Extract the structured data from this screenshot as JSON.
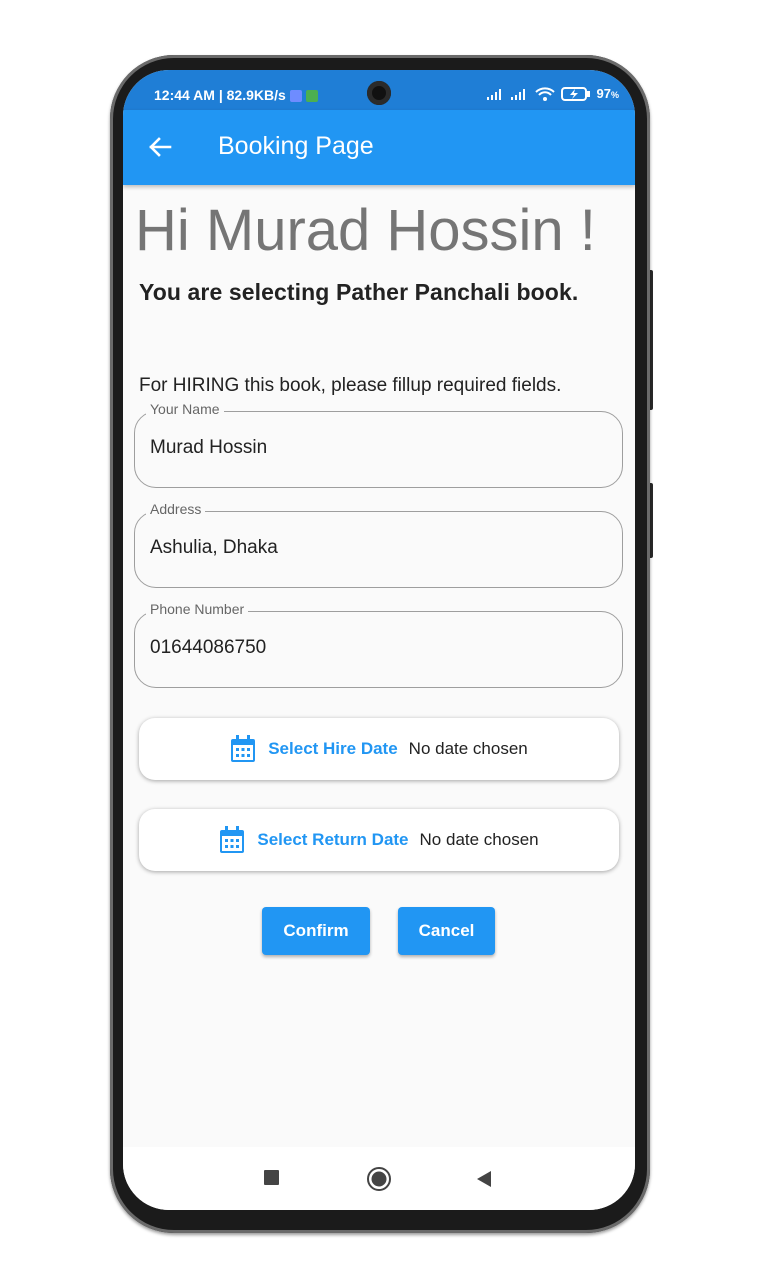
{
  "status_bar": {
    "time": "12:44 AM | 82.9KB/s",
    "battery": "97",
    "battery_unit": "%",
    "badge_colors": [
      "#6e8cff",
      "#4caf50"
    ]
  },
  "app_bar": {
    "title": "Booking Page",
    "back_icon": "arrow-back-icon"
  },
  "greeting": "Hi Murad Hossin !",
  "selection_text": "You are selecting Pather Panchali book.",
  "instruction": "For HIRING this book, please fillup required fields.",
  "fields": [
    {
      "label": "Your Name",
      "value": "Murad Hossin"
    },
    {
      "label": "Address",
      "value": "Ashulia, Dhaka"
    },
    {
      "label": "Phone Number",
      "value": "01644086750"
    }
  ],
  "date_buttons": [
    {
      "label": "Select Hire Date",
      "value": "No date chosen",
      "icon": "calendar-icon"
    },
    {
      "label": "Select Return Date",
      "value": "No date chosen",
      "icon": "calendar-icon"
    }
  ],
  "actions": {
    "confirm": "Confirm",
    "cancel": "Cancel"
  },
  "nav_bar": [
    "recents-square-icon",
    "home-circle-icon",
    "back-triangle-icon"
  ],
  "colors": {
    "primary": "#2196f3",
    "status_bar": "#1f7ed6",
    "background": "#fafafa"
  }
}
